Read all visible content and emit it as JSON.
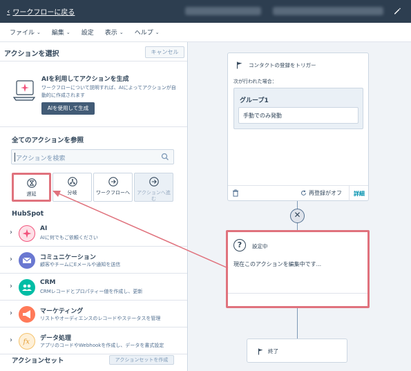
{
  "topbar": {
    "back_label": "ワークフローに戻る"
  },
  "menubar": {
    "items": [
      {
        "label": "ファイル",
        "has_caret": true
      },
      {
        "label": "編集",
        "has_caret": true
      },
      {
        "label": "設定",
        "has_caret": false
      },
      {
        "label": "表示",
        "has_caret": true
      },
      {
        "label": "ヘルプ",
        "has_caret": true
      }
    ]
  },
  "panel": {
    "title": "アクションを選択",
    "cancel_label": "キャンセル",
    "ai": {
      "title": "AIを利用してアクションを生成",
      "description": "ワークフローについて説明すれば、AIによってアクションが自動的に作成されます",
      "button_label": "AIを使用して生成"
    },
    "browse_title": "全てのアクションを参照",
    "search_placeholder": "アクションを検索",
    "tiles": [
      {
        "label": "遅延",
        "icon": "hourglass-icon"
      },
      {
        "label": "分岐",
        "icon": "branch-icon"
      },
      {
        "label": "ワークフローへ",
        "icon": "arrow-circle-icon"
      },
      {
        "label": "アクションへ進む",
        "icon": "arrow-circle-icon"
      }
    ],
    "hubspot_title": "HubSpot",
    "categories": [
      {
        "name": "AI",
        "desc": "AIに何でもご依頼ください",
        "color": "#f2547d",
        "icon": "sparkle-icon"
      },
      {
        "name": "コミュニケーション",
        "desc": "顧客やチームにEメールや通知を送信",
        "color": "#6a78d1",
        "icon": "envelope-icon"
      },
      {
        "name": "CRM",
        "desc": "CRMレコードとプロパティー値を作成し、更新",
        "color": "#00bda5",
        "icon": "people-icon"
      },
      {
        "name": "マーケティング",
        "desc": "リストやオーディエンスのレコードやステータスを管理",
        "color": "#ff7a59",
        "icon": "megaphone-icon"
      },
      {
        "name": "データ処理",
        "desc": "アプリのコードやWebhookを作成し、データを書式設定",
        "color": "#f5c26b",
        "icon": "function-icon"
      }
    ],
    "action_set_title": "アクションセット",
    "action_set_button": "アクションセットを作成"
  },
  "canvas": {
    "trigger": {
      "title": "コンタクトの登録をトリガー",
      "subtitle": "次が行われた場合：",
      "group_name": "グループ1",
      "group_value": "手動でのみ発動",
      "reenroll_label": "再登録がオフ",
      "detail_label": "詳細"
    },
    "editing": {
      "title": "設定中",
      "text": "現在このアクションを編集中です..."
    },
    "end_label": "終了"
  },
  "colors": {
    "topbar": "#2d3e50",
    "highlight": "#e0727d",
    "primary_button": "#425b76",
    "link": "#0091ae"
  }
}
